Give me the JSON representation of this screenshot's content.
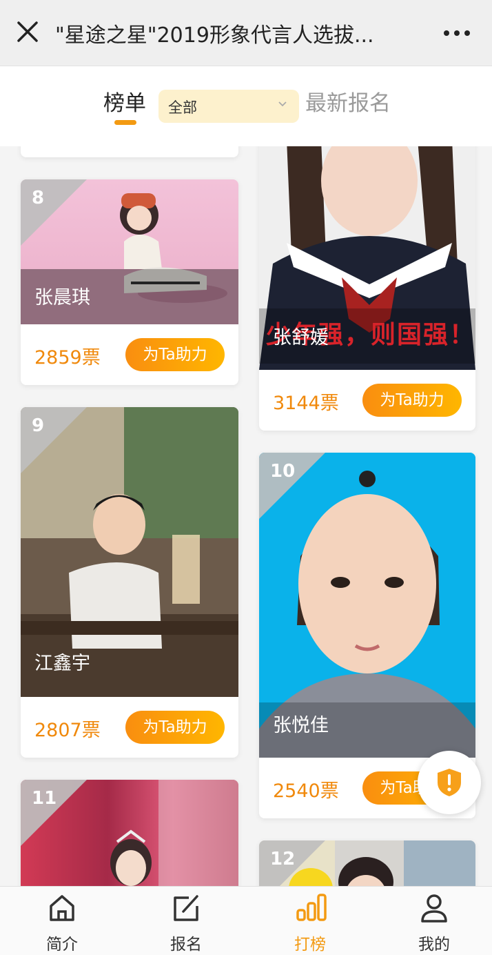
{
  "header": {
    "title": "\"星途之星\"2019形象代言人选拔...",
    "close_icon": "close-icon",
    "more_icon": "more-icon"
  },
  "tabs": {
    "board": "榜单",
    "filter_value": "全部",
    "latest": "最新报名"
  },
  "vote_label": "为Ta助力",
  "cards": [
    {
      "rank": "8",
      "name": "张晨琪",
      "votes": "2859票"
    },
    {
      "rank": "",
      "name": "张舒媛",
      "votes": "3144票",
      "banner": "少年强，则国强！"
    },
    {
      "rank": "9",
      "name": "江鑫宇",
      "votes": "2807票"
    },
    {
      "rank": "10",
      "name": "张悦佳",
      "votes": "2540票"
    },
    {
      "rank": "11",
      "name": "",
      "votes": ""
    },
    {
      "rank": "12",
      "name": "",
      "votes": ""
    }
  ],
  "colors": {
    "accent": "#f39a12",
    "votes": "#f0890c",
    "filter_bg": "#fdf1cd"
  },
  "nav": [
    {
      "label": "简介",
      "icon": "home-icon"
    },
    {
      "label": "报名",
      "icon": "edit-icon"
    },
    {
      "label": "打榜",
      "icon": "bar-chart-icon"
    },
    {
      "label": "我的",
      "icon": "user-icon"
    }
  ]
}
